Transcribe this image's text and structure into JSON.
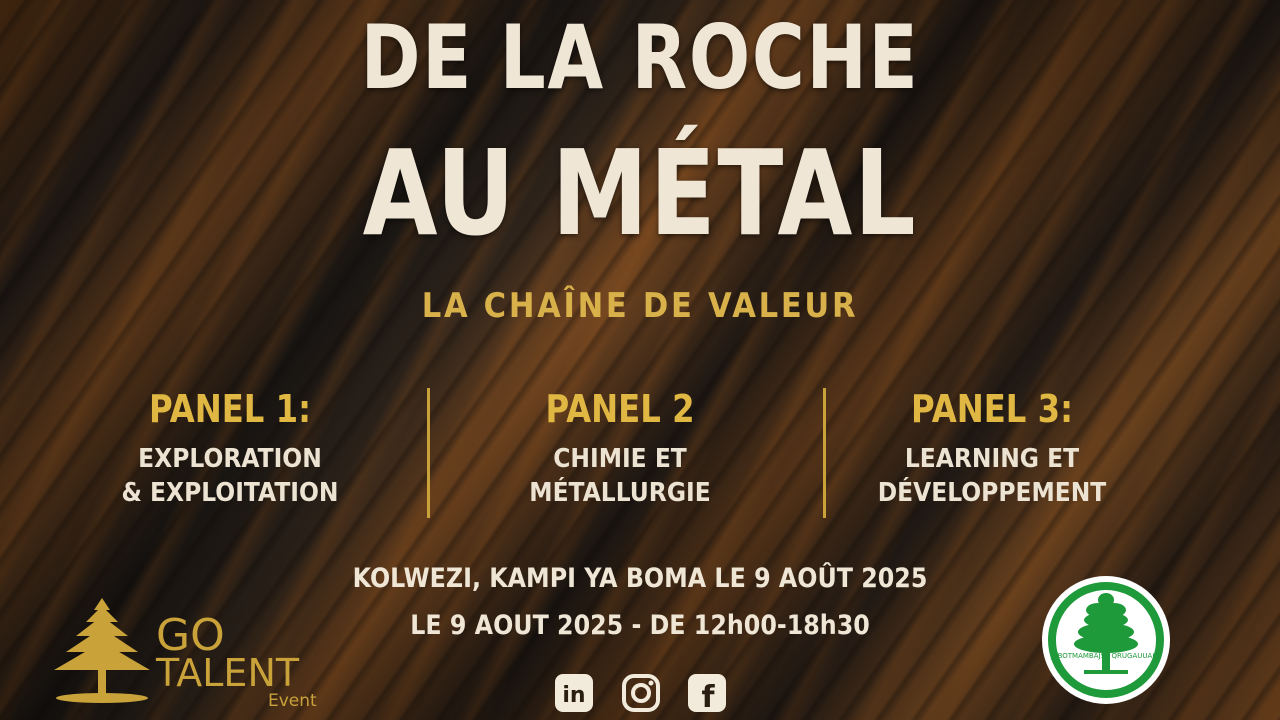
{
  "title": {
    "line1": "DE LA ROCHE",
    "line2": "AU MÉTAL",
    "subtitle": "LA CHAÎNE DE VALEUR"
  },
  "panels": [
    {
      "title": "PANEL 1:",
      "desc_line1": "EXPLORATION",
      "desc_line2": "& EXPLOITATION"
    },
    {
      "title": "PANEL 2",
      "desc_line1": "CHIMIE ET",
      "desc_line2": "MÉTALLURGIE"
    },
    {
      "title": "PANEL 3:",
      "desc_line1": "LEARNING ET",
      "desc_line2": "DÉVELOPPEMENT"
    }
  ],
  "event": {
    "location_line": "KOLWEZI, KAMPI YA BOMA  LE 9 AOÛT 2025",
    "date_line": "LE 9 AOUT 2025 - DE 12h00-18h30"
  },
  "logo_left": {
    "line1": "GO",
    "line2": "TALENT",
    "line3": "Event"
  },
  "logo_right": {
    "text": "JABOTMAMBAJSY QRUGAUUALA"
  },
  "social": [
    {
      "icon": "linkedin-icon",
      "label": "in"
    },
    {
      "icon": "instagram-icon"
    },
    {
      "icon": "facebook-icon",
      "label": "f"
    }
  ],
  "colors": {
    "title": "#efe6d6",
    "accent_gold": "#e0b743",
    "logo_green": "#1f9a3a"
  }
}
